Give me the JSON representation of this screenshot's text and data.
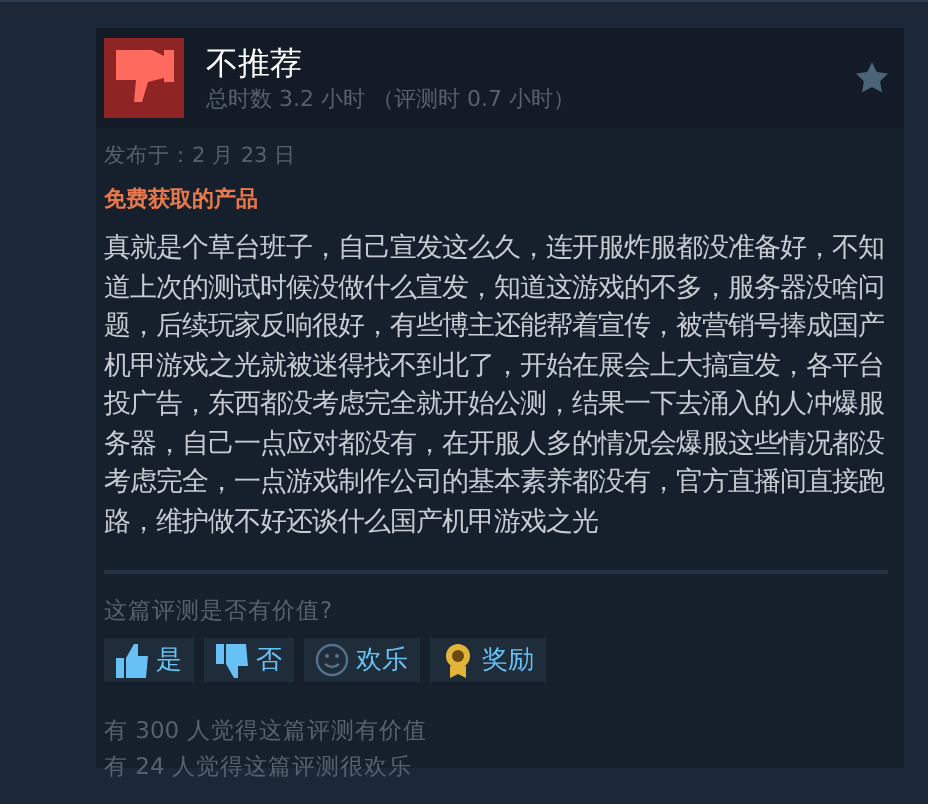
{
  "review": {
    "verdict": "不推荐",
    "recommended": false,
    "playtime": "总时数 3.2 小时 （评测时 0.7 小时）",
    "posted": "发布于：2 月 23 日",
    "product_note": "免费获取的产品",
    "body": "真就是个草台班子，自己宣发这么久，连开服炸服都没准备好，不知道上次的测试时候没做什么宣发，知道这游戏的不多，服务器没啥问题，后续玩家反响很好，有些博主还能帮着宣传，被营销号捧成国产机甲游戏之光就被迷得找不到北了，开始在展会上大搞宣发，各平台投广告，东西都没考虑完全就开始公测，结果一下去涌入的人冲爆服务器，自己一点应对都没有，在开服人多的情况会爆服这些情况都没考虑完全，一点游戏制作公司的基本素养都没有，官方直播间直接跑路，维护做不好还谈什么国产机甲游戏之光"
  },
  "feedback": {
    "question": "这篇评测是否有价值?",
    "buttons": [
      {
        "kind": "thumbs-up",
        "label": "是"
      },
      {
        "kind": "thumbs-down",
        "label": "否"
      },
      {
        "kind": "smile",
        "label": "欢乐"
      },
      {
        "kind": "award",
        "label": "奖励"
      }
    ],
    "counts": [
      "有 300 人觉得这篇评测有价值",
      "有 24 人觉得这篇评测很欢乐"
    ]
  }
}
